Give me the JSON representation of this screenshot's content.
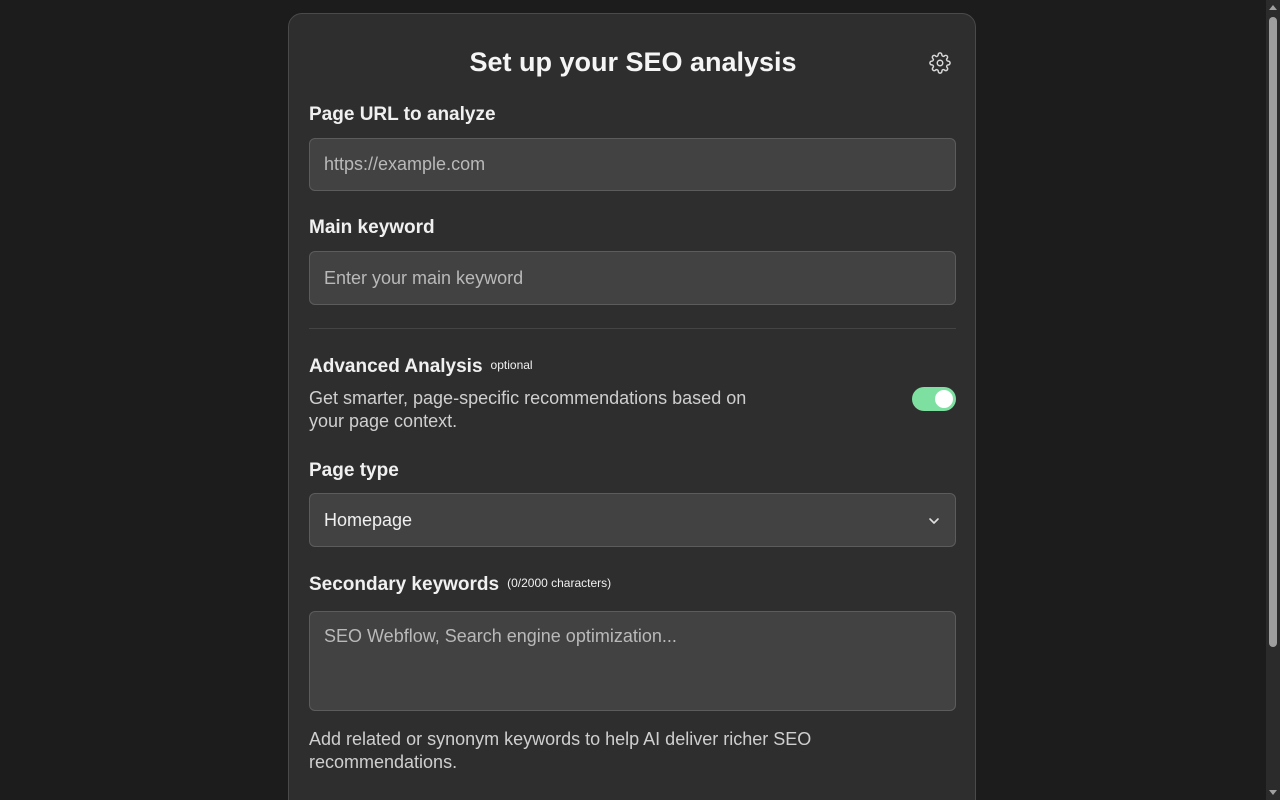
{
  "form": {
    "title": "Set up your SEO analysis",
    "settings_icon": "gear-icon",
    "page_url": {
      "label": "Page URL to analyze",
      "placeholder": "https://example.com",
      "value": ""
    },
    "main_keyword": {
      "label": "Main keyword",
      "placeholder": "Enter your main keyword",
      "value": ""
    },
    "advanced": {
      "label": "Advanced Analysis",
      "badge": "optional",
      "description_line1": "Get smarter, page-specific recommendations based on",
      "description_line2": "your page context.",
      "enabled": true,
      "toggle_color": "#7ee0a0"
    },
    "page_type": {
      "label": "Page type",
      "selected": "Homepage",
      "chevron_icon": "chevron-down-icon"
    },
    "secondary_keywords": {
      "label": "Secondary keywords",
      "counter": "(0/2000 characters)",
      "placeholder": "SEO Webflow, Search engine optimization...",
      "value": "",
      "help_line1": "Add related or synonym keywords to help AI deliver richer SEO",
      "help_line2": "recommendations."
    }
  }
}
